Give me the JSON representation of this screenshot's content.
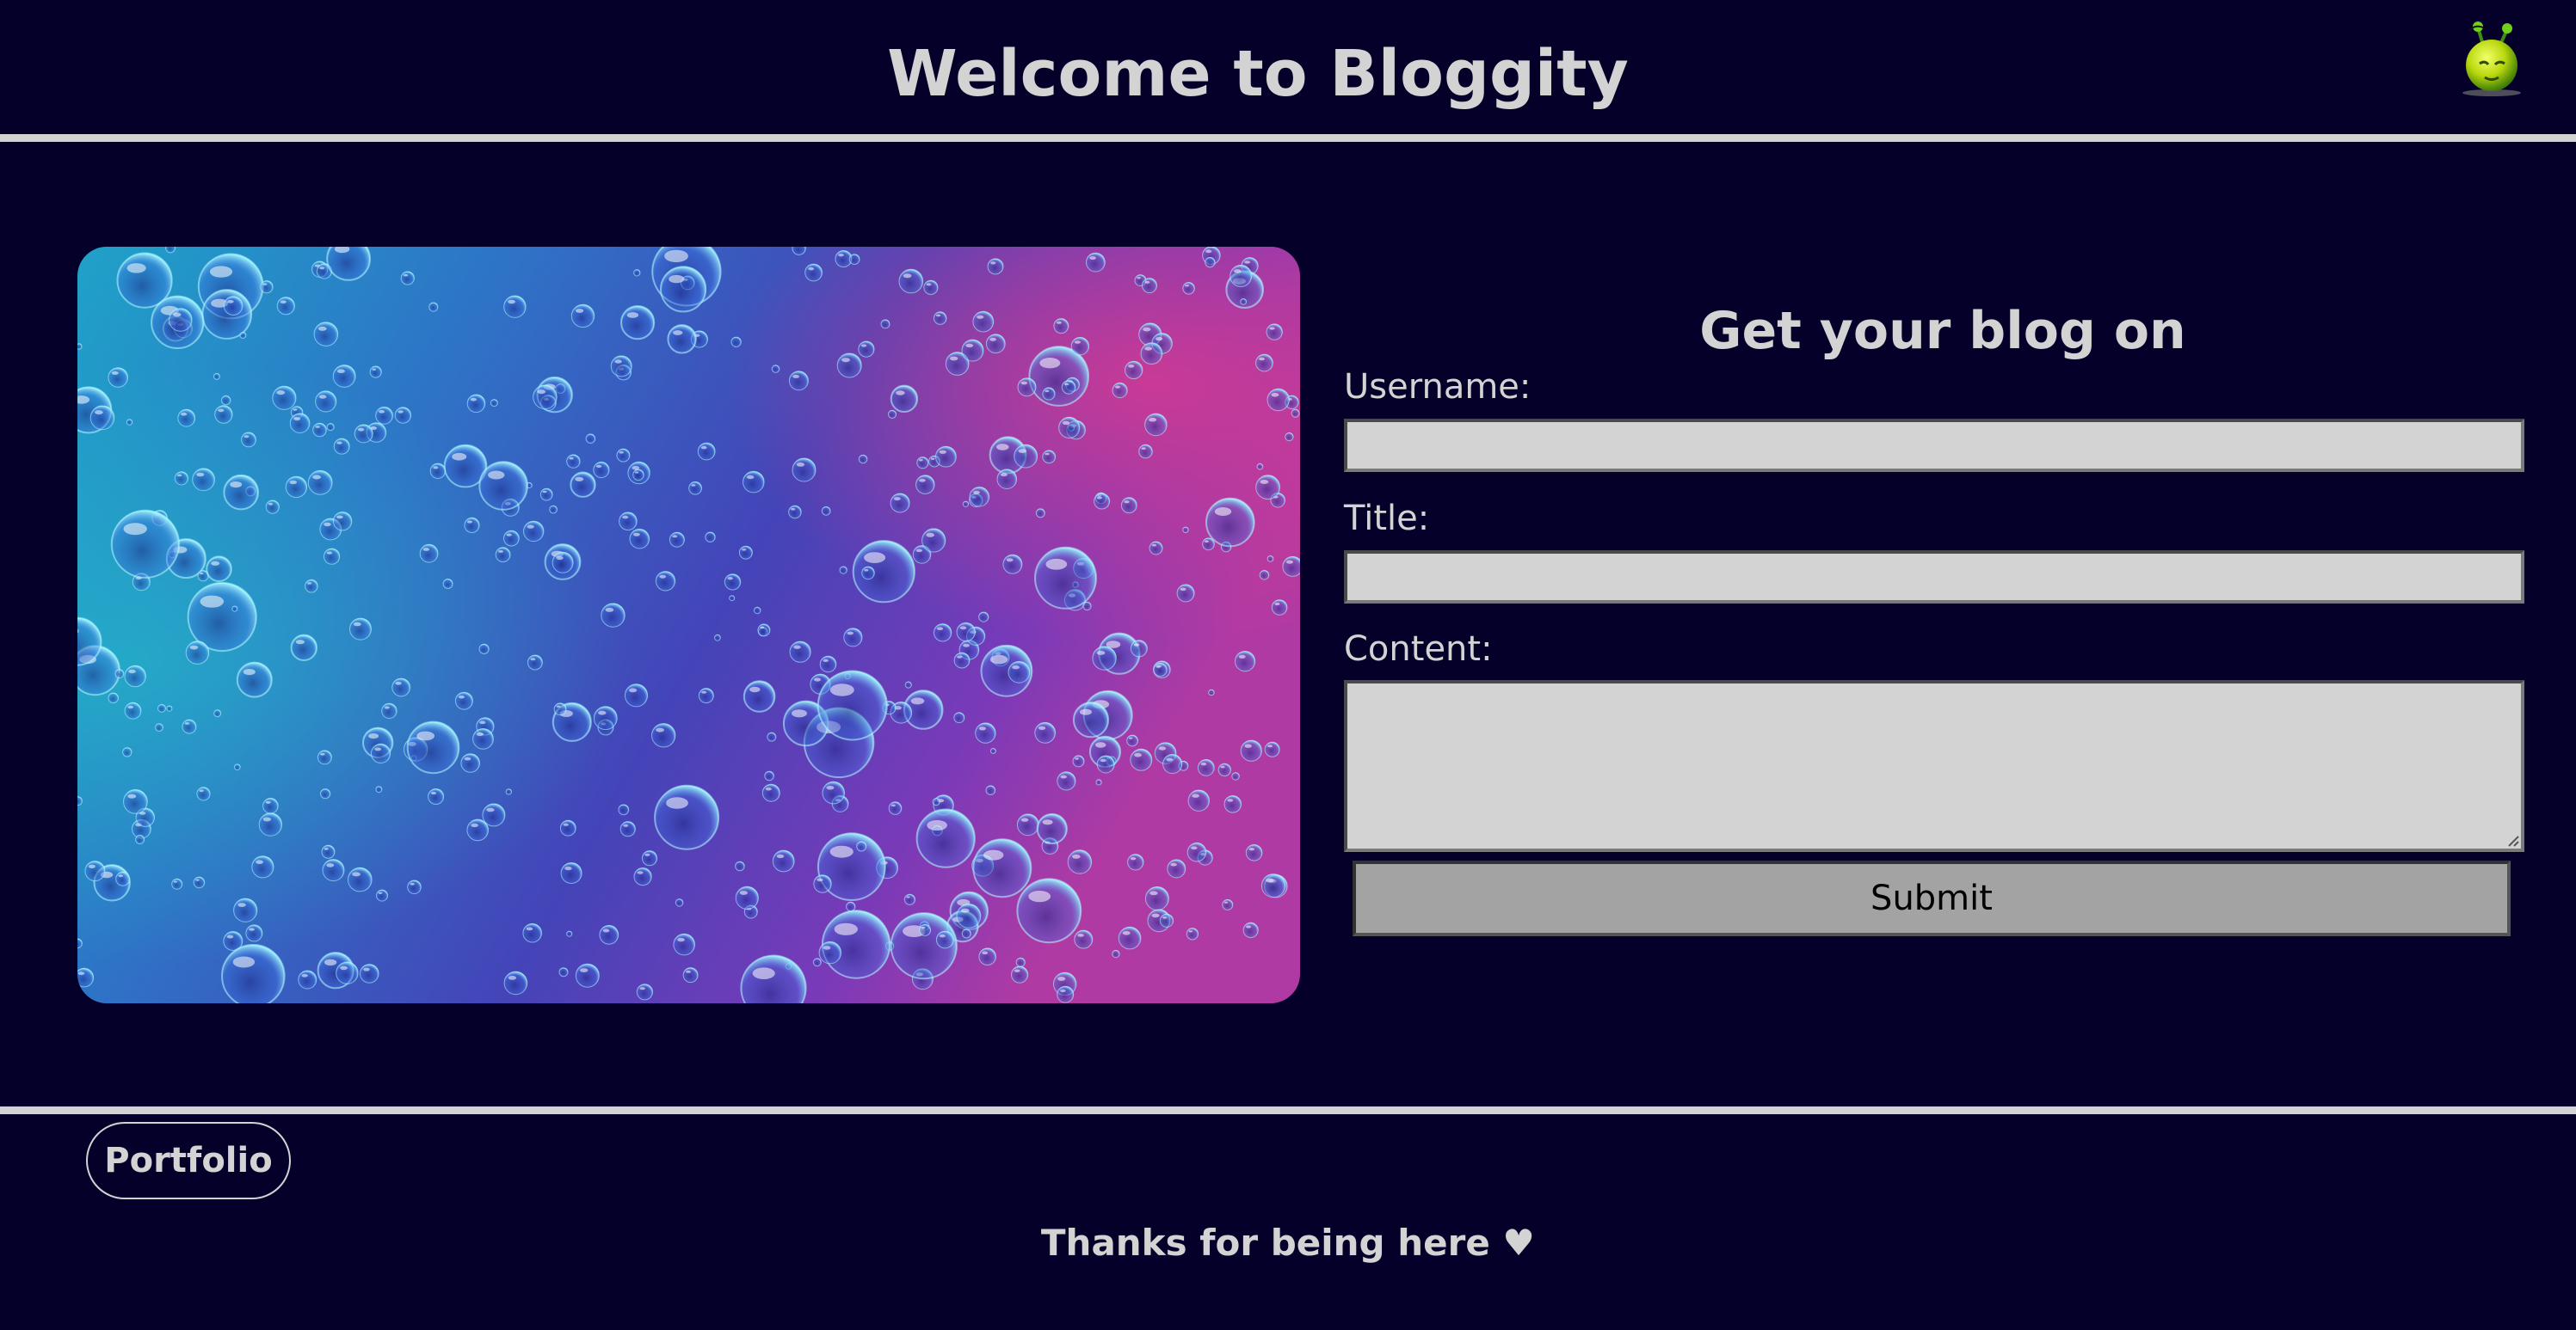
{
  "header": {
    "title": "Welcome to Bloggity",
    "logo_icon": "alien-mascot-icon"
  },
  "main": {
    "image_description_icon": "water-droplets-image",
    "form": {
      "heading": "Get your blog on",
      "username_label": "Username:",
      "username_value": "",
      "title_label": "Title:",
      "title_value": "",
      "content_label": "Content:",
      "content_value": "",
      "submit_label": "Submit"
    }
  },
  "footer": {
    "portfolio_label": "Portfolio",
    "thanks_text": "Thanks for being here ♥"
  },
  "colors": {
    "background": "#05002a",
    "text": "#d3d3d3",
    "input_bg": "#d3d3d3",
    "button_bg": "#a3a3a3"
  }
}
